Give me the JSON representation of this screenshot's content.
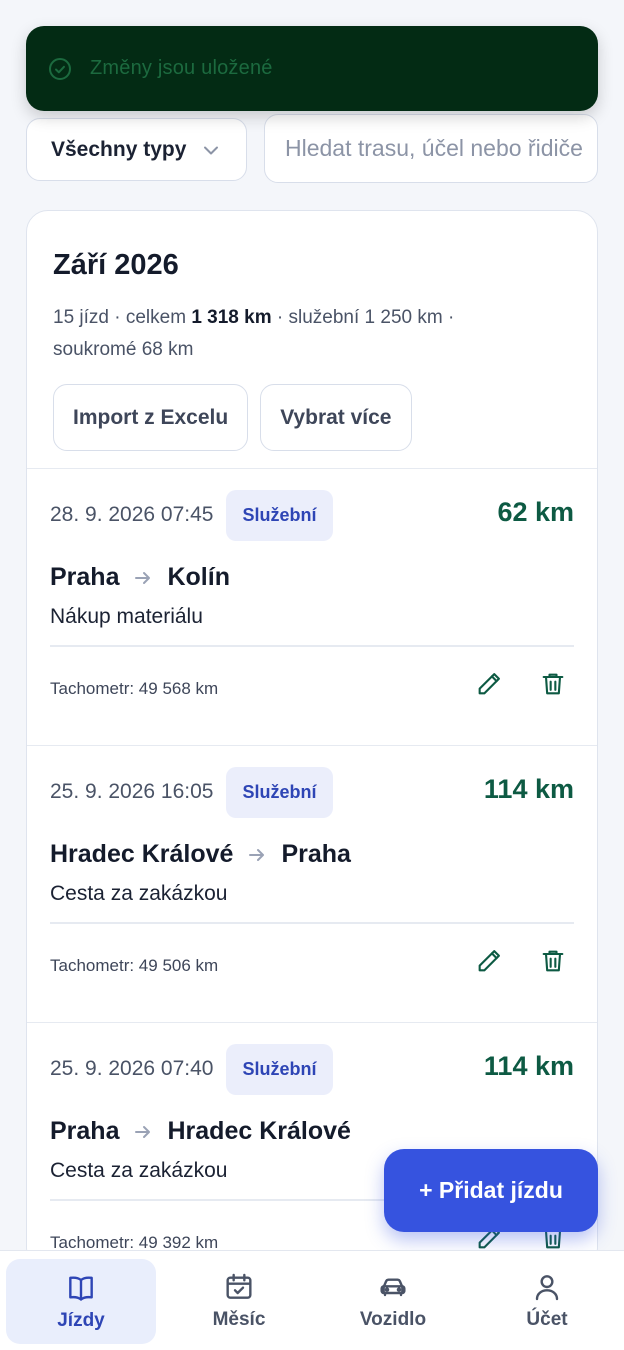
{
  "toast": {
    "text": "Změny jsou uložené",
    "icon": "check-circle-icon"
  },
  "filter": {
    "type_label": "Všechny typy",
    "search_placeholder": "Hledat trasu, účel nebo řidiče"
  },
  "month": {
    "title": "Září 2026",
    "summary_prefix": "15 jízd · celkem ",
    "summary_total": "1 318 km",
    "summary_suffix": " · služební 1 250 km · soukromé 68 km",
    "import_label": "Import z Excelu",
    "select_label": "Vybrat více"
  },
  "trips": [
    {
      "datetime": "28. 9. 2026 07:45",
      "type": "Služební",
      "km": "62 km",
      "from": "Praha",
      "to": "Kolín",
      "purpose": "Nákup materiálu",
      "odometer": "Tachometr: 49 568 km"
    },
    {
      "datetime": "25. 9. 2026 16:05",
      "type": "Služební",
      "km": "114 km",
      "from": "Hradec Králové",
      "to": "Praha",
      "purpose": "Cesta za zakázkou",
      "odometer": "Tachometr: 49 506 km"
    },
    {
      "datetime": "25. 9. 2026 07:40",
      "type": "Služební",
      "km": "114 km",
      "from": "Praha",
      "to": "Hradec Králové",
      "purpose": "Cesta za zakázkou",
      "odometer": "Tachometr: 49 392 km"
    }
  ],
  "fab": {
    "label": "+ Přidat jízdu"
  },
  "nav": [
    {
      "label": "Jízdy",
      "icon": "book-icon",
      "active": true
    },
    {
      "label": "Měsíc",
      "icon": "calendar-check-icon",
      "active": false
    },
    {
      "label": "Vozidlo",
      "icon": "car-icon",
      "active": false
    },
    {
      "label": "Účet",
      "icon": "user-icon",
      "active": false
    }
  ],
  "colors": {
    "accent": "#3653df",
    "km_green": "#0d5a43",
    "toast_bg": "#032b14",
    "badge_bg": "#ebeefb"
  }
}
